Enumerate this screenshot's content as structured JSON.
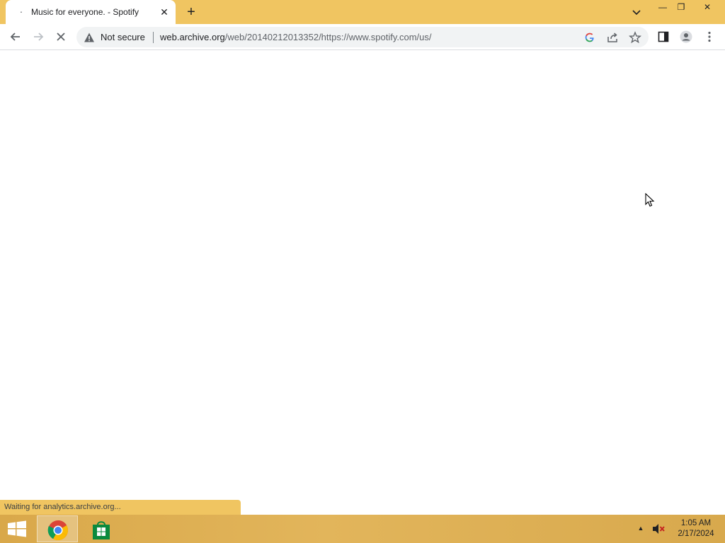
{
  "browser": {
    "tab": {
      "title": "Music for everyone. - Spotify",
      "favicon": "loading-dot",
      "close_glyph": "✕"
    },
    "new_tab_glyph": "+",
    "window_controls": {
      "minimize": "—",
      "restore": "❐",
      "close": "✕"
    },
    "toolbar": {
      "security_label": "Not secure",
      "url_host": "web.archive.org",
      "url_path": "/web/20140212013352/https://www.spotify.com/us/"
    },
    "status_text": "Waiting for analytics.archive.org..."
  },
  "taskbar": {
    "apps": [
      {
        "name": "chrome",
        "active": true
      },
      {
        "name": "store",
        "active": false
      }
    ],
    "tray_chevron": "▲",
    "clock": {
      "time": "1:05 AM",
      "date": "2/17/2024"
    }
  },
  "colors": {
    "accent": "#f0c561",
    "taskbar": "#e2b55b"
  }
}
